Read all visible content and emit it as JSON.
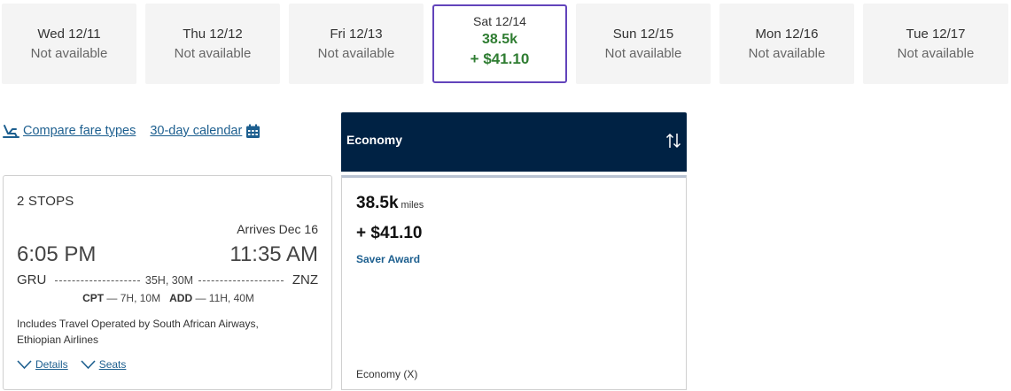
{
  "dates": [
    {
      "label": "Wed 12/11",
      "status": "Not available"
    },
    {
      "label": "Thu 12/12",
      "status": "Not available"
    },
    {
      "label": "Fri 12/13",
      "status": "Not available"
    },
    {
      "label": "Sat 12/14",
      "miles": "38.5k",
      "price": "+ $41.10"
    },
    {
      "label": "Sun 12/15",
      "status": "Not available"
    },
    {
      "label": "Mon 12/16",
      "status": "Not available"
    },
    {
      "label": "Tue 12/17",
      "status": "Not available"
    }
  ],
  "toolbar": {
    "compare_label": "Compare fare types",
    "calendar_label": "30-day calendar"
  },
  "flight": {
    "stops": "2 STOPS",
    "arrives": "Arrives Dec 16",
    "depart_time": "6:05 PM",
    "arrive_time": "11:35 AM",
    "origin": "GRU",
    "destination": "ZNZ",
    "duration": "35H, 30M",
    "layover1_code": "CPT",
    "layover1_time": "— 7H, 10M",
    "layover2_code": "ADD",
    "layover2_time": "— 11H, 40M",
    "operated_by": "Includes Travel Operated by South African Airways, Ethiopian Airlines",
    "details_label": "Details",
    "seats_label": "Seats"
  },
  "economy": {
    "header": "Economy",
    "miles": "38.5k",
    "miles_unit": "miles",
    "price": "+ $41.10",
    "award": "Saver Award",
    "fare_class": "Economy (X)"
  },
  "colors": {
    "selected_border": "#6244bb",
    "award_green": "#2f7d32",
    "link_blue": "#1d5f8f",
    "header_navy": "#002244"
  }
}
